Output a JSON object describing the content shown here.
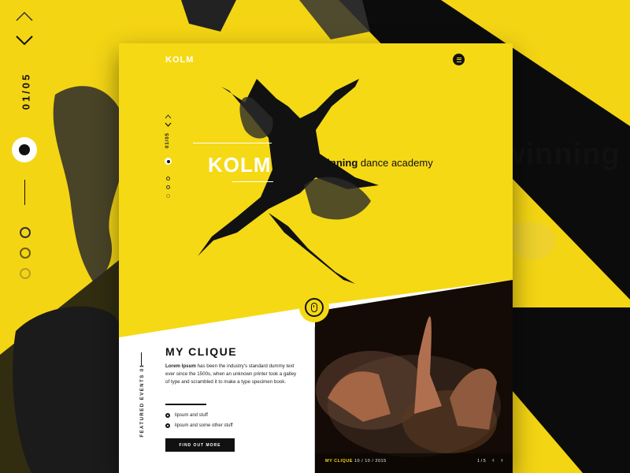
{
  "colors": {
    "accent": "#f5d915",
    "dark": "#111111",
    "white": "#ffffff"
  },
  "background": {
    "counter": "01/05",
    "headline_fragment": "winning",
    "nav_icons": [
      "chevron-up-icon",
      "chevron-down-icon"
    ]
  },
  "card": {
    "logo": "KOLM",
    "menu_icon": "menu-icon",
    "counter": "01/05",
    "hero": {
      "title": "KOLM",
      "subtitle_bold": "award winning",
      "subtitle_rest": "dance academy"
    },
    "section": {
      "vertical_label": "FEATURED EVENTS 01",
      "title": "MY CLIQUE",
      "body_bold": "Lorem Ipsum",
      "body_rest": "has been the industry's standard dummy text ever since the 1500s, when an unknown printer took a galley of type and scrambled it to make a type specimen book.",
      "bullets": [
        "lipsum and stuff",
        "lipsum and some other stuff"
      ],
      "button_label": "FIND OUT MORE"
    },
    "photo": {
      "caption_title": "MY CLIQUE",
      "caption_date": "10 / 10 / 2015",
      "pager": "1 / 5",
      "prev_icon": "chevron-left-icon",
      "next_icon": "chevron-right-icon"
    },
    "scroll_icon": "mouse-icon"
  }
}
